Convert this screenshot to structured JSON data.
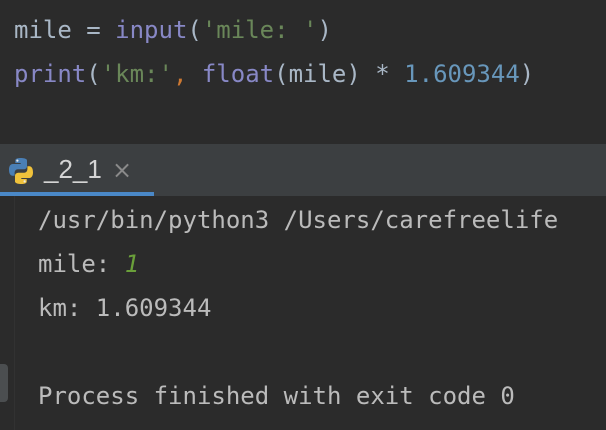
{
  "editor": {
    "line1": {
      "var": "mile",
      "eq": " = ",
      "func": "input",
      "open": "(",
      "arg": "'mile: '",
      "close": ")"
    },
    "line2": {
      "func": "print",
      "open": "(",
      "arg1": "'km:'",
      "comma": ", ",
      "func2": "float",
      "open2": "(",
      "var": "mile",
      "close2": ")",
      "mul": " * ",
      "num": "1.609344",
      "close": ")"
    }
  },
  "run_tab": {
    "icon": "python-icon",
    "label": "_2_1",
    "close": "×"
  },
  "console": {
    "cmd": "/usr/bin/python3 /Users/carefreelife",
    "prompt": "mile: ",
    "input_value": "1",
    "result": "km: 1.609344",
    "status": "Process finished with exit code 0"
  },
  "colors": {
    "background": "#2b2b2b",
    "builtin": "#8888c6",
    "string": "#6a8759",
    "number": "#6897bb",
    "tab_accent": "#4a88c7",
    "user_input": "#6a9f3a"
  }
}
